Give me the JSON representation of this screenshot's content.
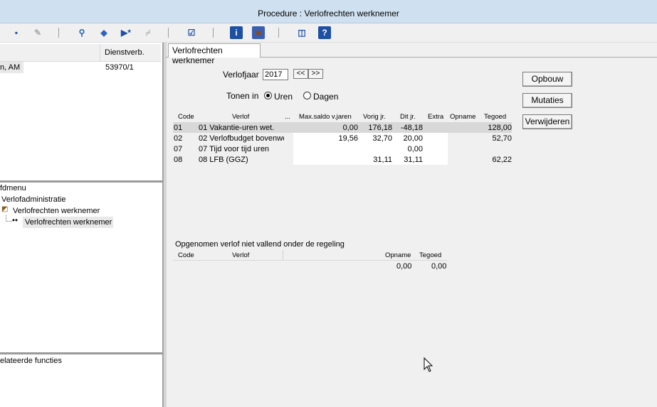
{
  "window": {
    "title": "Procedure : Verlofrechten werknemer"
  },
  "toolbar": {
    "buttons": [
      {
        "name": "save-icon",
        "glyph": "▪",
        "color": "#1d4fa3",
        "enabled": true
      },
      {
        "name": "edit-disabled-icon",
        "glyph": "✎",
        "color": "#b0b0b0",
        "enabled": false
      },
      {
        "name": "search-icon",
        "glyph": "⚲",
        "color": "#1d5fb8",
        "enabled": true
      },
      {
        "name": "eraser-icon",
        "glyph": "◆",
        "color": "#2a63c0",
        "enabled": true
      },
      {
        "name": "new-record-icon",
        "glyph": "▶*",
        "color": "#1d4fa3",
        "enabled": true
      },
      {
        "name": "delete-disabled-icon",
        "glyph": "⌿",
        "color": "#b0b0b0",
        "enabled": false
      },
      {
        "name": "checklist-icon",
        "glyph": "☑",
        "color": "#1d4fa3",
        "enabled": true
      },
      {
        "name": "info-icon",
        "glyph": "i",
        "color": "#ffffff",
        "bg": "#1d4fa3",
        "enabled": true
      },
      {
        "name": "person-icon",
        "glyph": "☻",
        "color": "#8a4a1a",
        "bg": "#3a5fb0",
        "enabled": true
      },
      {
        "name": "window-icon",
        "glyph": "◫",
        "color": "#1d4fa3",
        "enabled": true
      },
      {
        "name": "help-icon",
        "glyph": "?",
        "color": "#ffffff",
        "bg": "#1d4fa3",
        "enabled": true
      }
    ]
  },
  "employee_list": {
    "header_col2": "Dienstverb.",
    "rows": [
      {
        "name": "n, AM",
        "dienstverband": "53970/1"
      }
    ]
  },
  "menu_tree": {
    "items": [
      {
        "label": "fdmenu",
        "level": 0
      },
      {
        "label": "Verlofadministratie",
        "level": 1
      },
      {
        "label": "Verlofrechten werknemer",
        "level": 2
      },
      {
        "label": "Verlofrechten werknemer",
        "level": 3,
        "selected": true
      }
    ]
  },
  "related": {
    "title": "elateerde functies"
  },
  "tab": {
    "label": "Verlofrechten werknemer"
  },
  "form": {
    "year_label": "Verlofjaar",
    "year_value": "2017",
    "prev_label": "<<",
    "next_label": ">>",
    "show_in_label": "Tonen in",
    "unit_hours": "Uren",
    "unit_days": "Dagen",
    "selected_unit": "hours"
  },
  "actions": {
    "build": "Opbouw",
    "mutations": "Mutaties",
    "delete": "Verwijderen"
  },
  "leave_table": {
    "headers": [
      "Code",
      "Verlof",
      "...",
      "Max.saldo v.jaren",
      "Vorig jr.",
      "Dit jr.",
      "Extra",
      "Opname",
      "Tegoed"
    ],
    "rows": [
      {
        "code": "01",
        "verlof": "01 Vakantie-uren wet.",
        "max": "0,00",
        "vorig": "176,18",
        "dit": "-48,18",
        "extra": "",
        "opname": "",
        "tegoed": "128,00"
      },
      {
        "code": "02",
        "verlof": "02 Verlofbudget bovenwe",
        "max": "19,56",
        "vorig": "32,70",
        "dit": "20,00",
        "extra": "",
        "opname": "",
        "tegoed": "52,70"
      },
      {
        "code": "07",
        "verlof": "07 Tijd voor tijd uren",
        "max": "",
        "vorig": "",
        "dit": "0,00",
        "extra": "",
        "opname": "",
        "tegoed": ""
      },
      {
        "code": "08",
        "verlof": "08 LFB (GGZ)",
        "max": "",
        "vorig": "31,11",
        "dit": "31,11",
        "extra": "",
        "opname": "",
        "tegoed": "62,22"
      }
    ]
  },
  "other_leave": {
    "title": "Opgenomen verlof niet vallend onder de regeling",
    "headers": [
      "Code",
      "Verlof",
      "Opname",
      "Tegoed"
    ],
    "totals": {
      "opname": "0,00",
      "tegoed": "0,00"
    }
  }
}
